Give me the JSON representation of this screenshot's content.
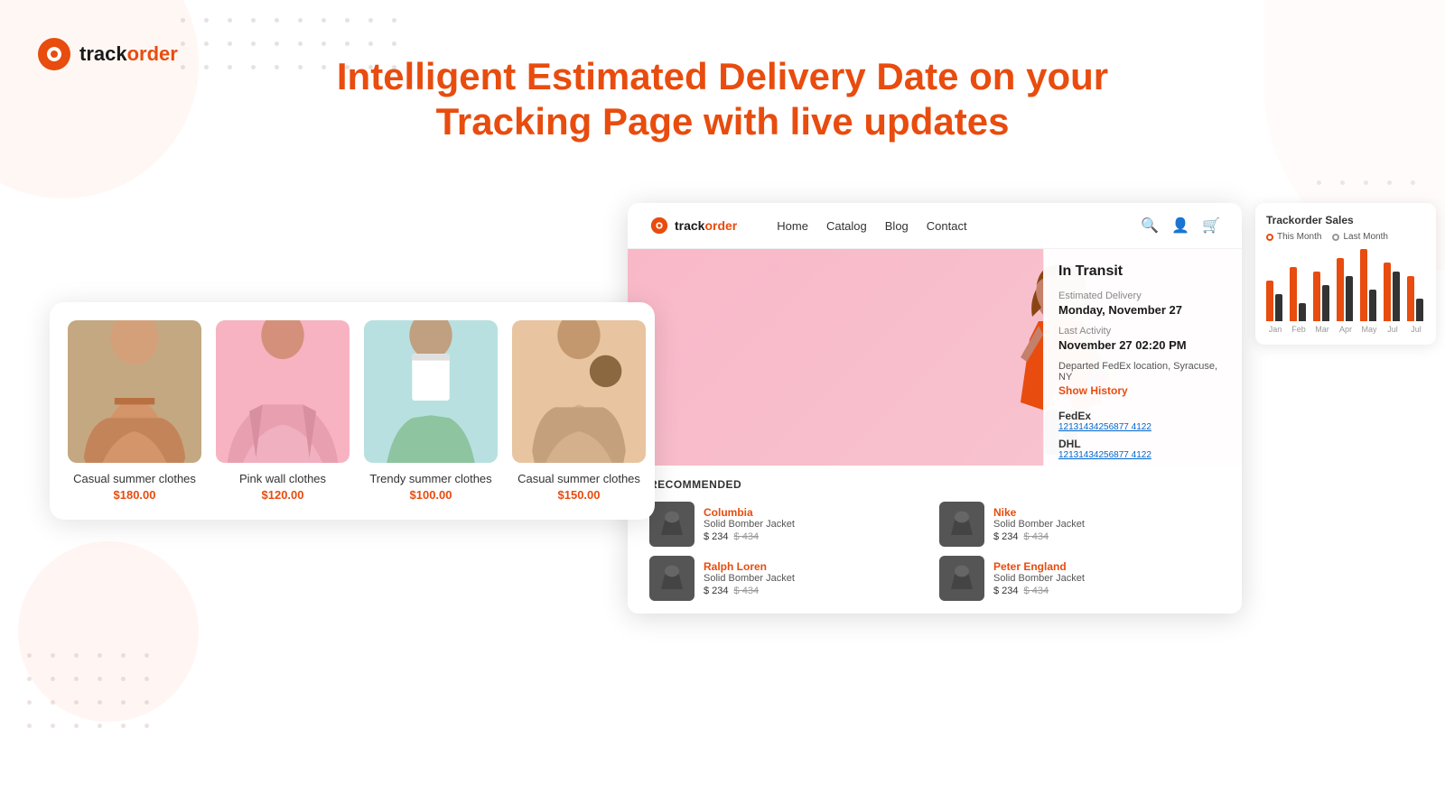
{
  "logo": {
    "text_before": "track",
    "text_after": "order",
    "icon": "📍"
  },
  "heading": {
    "line1": "Intelligent Estimated Delivery Date on your",
    "line2": "Tracking Page with live updates"
  },
  "products": [
    {
      "name": "Casual summer clothes",
      "price": "$180.00",
      "bg": "bg-tan",
      "figure_color": "#c4a882"
    },
    {
      "name": "Pink wall clothes",
      "price": "$120.00",
      "bg": "bg-pink",
      "figure_color": "#f7b3c2"
    },
    {
      "name": "Trendy summer clothes",
      "price": "$100.00",
      "bg": "bg-cyan",
      "figure_color": "#b8e0e0"
    },
    {
      "name": "Casual summer clothes",
      "price": "$150.00",
      "bg": "bg-peach",
      "figure_color": "#e8c4a0"
    }
  ],
  "store": {
    "nav": {
      "logo_text_before": "track",
      "logo_text_after": "order",
      "links": [
        "Home",
        "Catalog",
        "Blog",
        "Contact"
      ]
    }
  },
  "tracking": {
    "status": "In Transit",
    "estimated_label": "Estimated Delivery",
    "estimated_date": "Monday, November 27",
    "activity_label": "Last Activity",
    "activity_date": "November 27 02:20 PM",
    "activity_location": "Departed FedEx location, Syracuse, NY",
    "show_history_label": "Show History",
    "carriers": [
      {
        "name": "FedEx",
        "tracking_number": "12131434256877 4122"
      },
      {
        "name": "DHL",
        "tracking_number": "12131434256877 4122"
      }
    ]
  },
  "chart": {
    "title": "Trackorder Sales",
    "legend": {
      "this_month": "This Month",
      "last_month": "Last Month"
    },
    "labels": [
      "Jan",
      "Feb",
      "Mar",
      "Apr",
      "May",
      "Jul",
      "Jul"
    ],
    "bars": [
      {
        "orange": 45,
        "dark": 30
      },
      {
        "orange": 60,
        "dark": 20
      },
      {
        "orange": 55,
        "dark": 40
      },
      {
        "orange": 70,
        "dark": 50
      },
      {
        "orange": 80,
        "dark": 35
      },
      {
        "orange": 65,
        "dark": 55
      },
      {
        "orange": 50,
        "dark": 25
      }
    ]
  },
  "recommended": {
    "title": "RECOMMENDED",
    "items": [
      {
        "brand": "Columbia",
        "name": "Solid Bomber Jacket",
        "price": "$ 234",
        "old_price": "$ 434"
      },
      {
        "brand": "Nike",
        "name": "Solid Bomber Jacket",
        "price": "$ 234",
        "old_price": "$ 434"
      },
      {
        "brand": "Ralph Loren",
        "name": "Solid Bomber Jacket",
        "price": "$ 234",
        "old_price": "$ 434"
      },
      {
        "brand": "Peter England",
        "name": "Solid Bomber Jacket",
        "price": "$ 234",
        "old_price": "$ 434"
      }
    ]
  }
}
